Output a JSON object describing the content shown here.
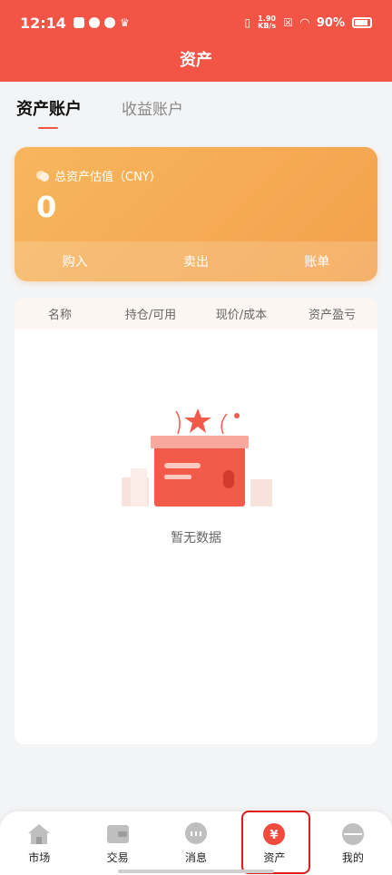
{
  "status_bar": {
    "time": "12:14",
    "net_speed": "1.90",
    "net_unit": "KB/s",
    "battery": "90%"
  },
  "header": {
    "title": "资产"
  },
  "tabs": [
    {
      "label": "资产账户",
      "active": true
    },
    {
      "label": "收益账户",
      "active": false
    }
  ],
  "asset_card": {
    "label": "总资产估值（CNY）",
    "value": "0",
    "actions": [
      "购入",
      "卖出",
      "账单"
    ]
  },
  "table": {
    "columns": [
      "名称",
      "持仓/可用",
      "现价/成本",
      "资产盈亏"
    ],
    "empty_text": "暂无数据"
  },
  "tabbar": {
    "items": [
      {
        "label": "市场",
        "icon": "house-icon"
      },
      {
        "label": "交易",
        "icon": "wallet-icon"
      },
      {
        "label": "消息",
        "icon": "chat-icon"
      },
      {
        "label": "资产",
        "icon": "yen-icon",
        "active": true
      },
      {
        "label": "我的",
        "icon": "profile-icon"
      }
    ]
  },
  "colors": {
    "brand": "#f25545",
    "card_gradient": "#f7b65d",
    "highlight_box": "#e01b1b"
  }
}
